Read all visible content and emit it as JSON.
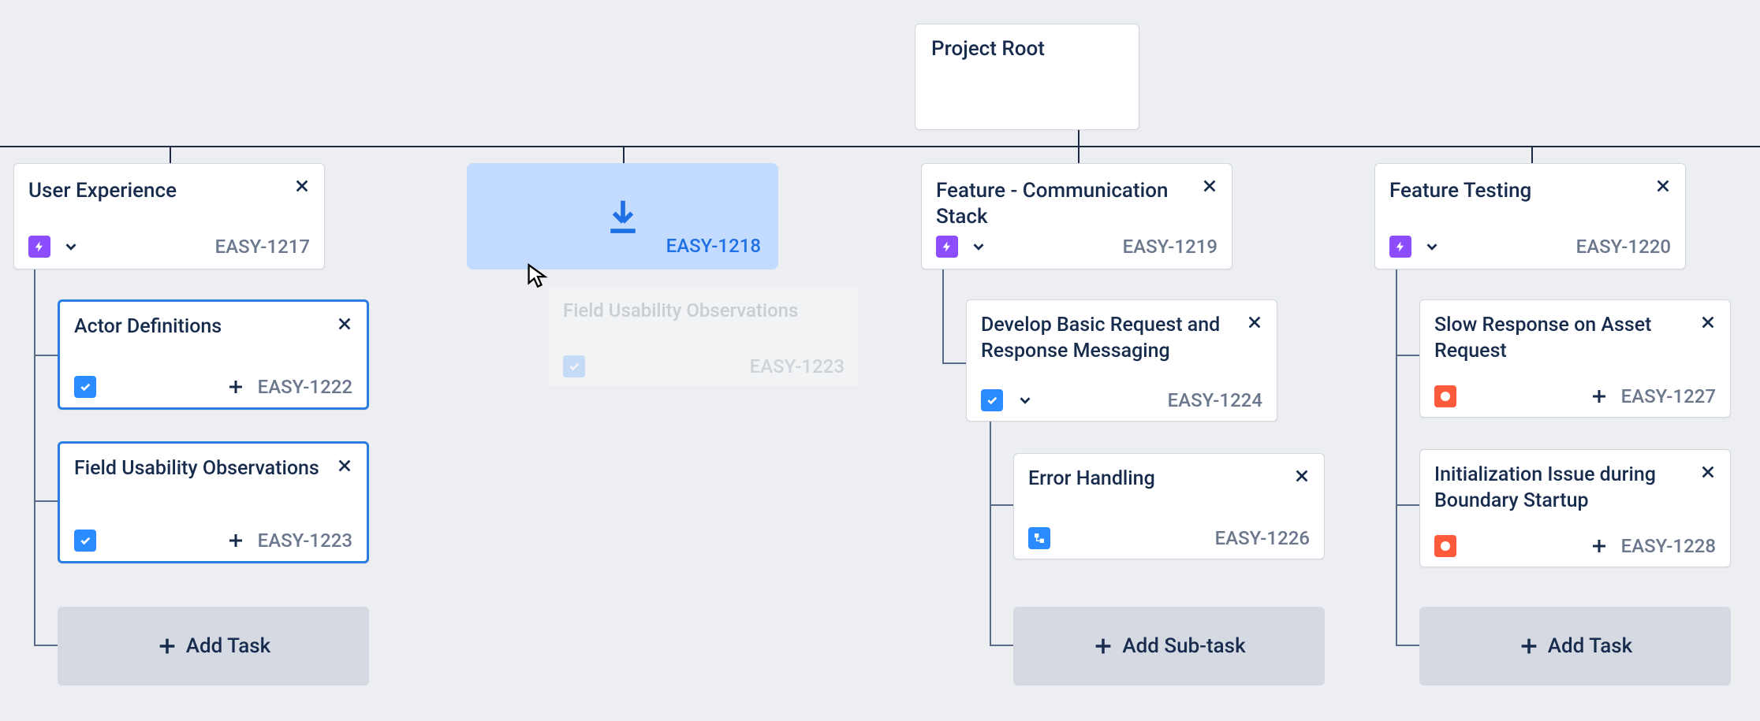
{
  "root": {
    "title": "Project Root"
  },
  "epics": [
    {
      "title": "User Experience",
      "id": "EASY-1217"
    },
    {
      "title": "",
      "id": "EASY-1218"
    },
    {
      "title": "Feature - Communication Stack",
      "id": "EASY-1219"
    },
    {
      "title": "Feature Testing",
      "id": "EASY-1220"
    }
  ],
  "ghost": {
    "title": "Field Usability Observations",
    "id": "EASY-1223"
  },
  "column0": {
    "tasks": [
      {
        "title": "Actor Definitions",
        "id": "EASY-1222"
      },
      {
        "title": "Field Usability Observations",
        "id": "EASY-1223"
      }
    ],
    "add_label": "Add Task"
  },
  "column2": {
    "tasks": [
      {
        "title": "Develop Basic Request and Response Messaging",
        "id": "EASY-1224"
      }
    ],
    "subtasks": [
      {
        "title": "Error Handling",
        "id": "EASY-1226"
      }
    ],
    "add_label": "Add Sub-task"
  },
  "column3": {
    "tasks": [
      {
        "title": "Slow Response on Asset Request",
        "id": "EASY-1227"
      },
      {
        "title": "Initialization Issue during Boundary Startup",
        "id": "EASY-1228"
      }
    ],
    "add_label": "Add Task"
  }
}
